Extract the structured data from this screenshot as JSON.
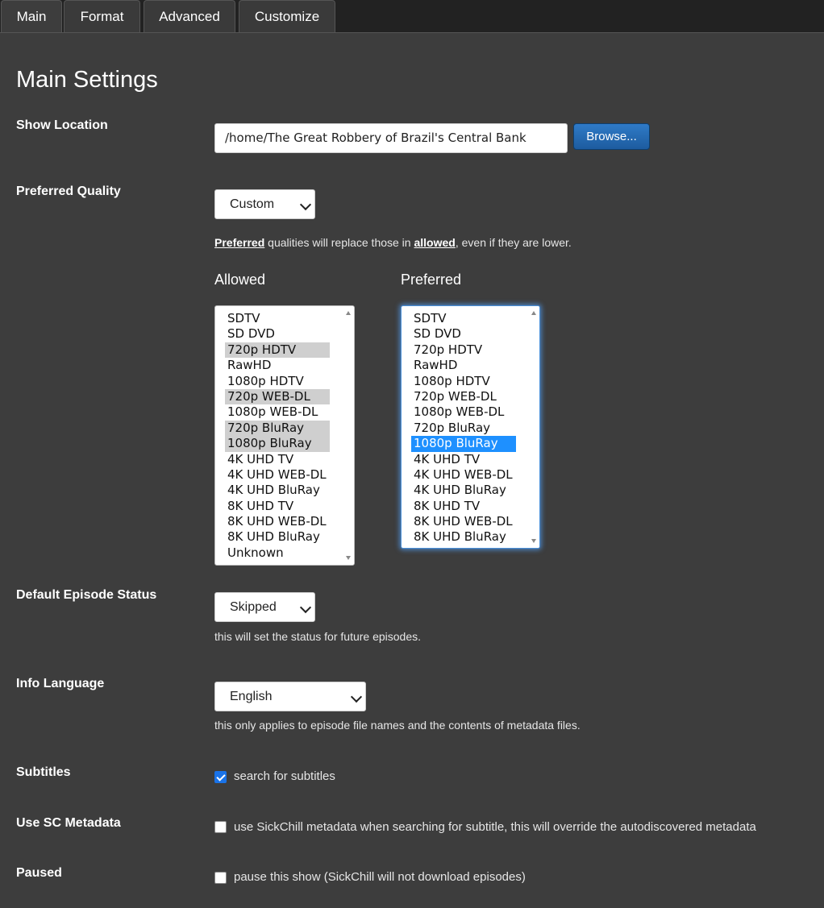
{
  "tabs": [
    {
      "label": "Main",
      "active": true
    },
    {
      "label": "Format",
      "active": false
    },
    {
      "label": "Advanced",
      "active": false
    },
    {
      "label": "Customize",
      "active": false
    }
  ],
  "page_title": "Main Settings",
  "show_location": {
    "label": "Show Location",
    "value": "/home/The Great Robbery of Brazil's Central Bank",
    "browse_label": "Browse..."
  },
  "preferred_quality": {
    "label": "Preferred Quality",
    "selected": "Custom",
    "hint_preferred": "Preferred",
    "hint_mid": " qualities will replace those in ",
    "hint_allowed": "allowed",
    "hint_end": ", even if they are lower.",
    "allowed_title": "Allowed",
    "preferred_title": "Preferred",
    "allowed_options": [
      "SDTV",
      "SD DVD",
      "720p HDTV",
      "RawHD",
      "1080p HDTV",
      "720p WEB-DL",
      "1080p WEB-DL",
      "720p BluRay",
      "1080p BluRay",
      "4K UHD TV",
      "4K UHD WEB-DL",
      "4K UHD BluRay",
      "8K UHD TV",
      "8K UHD WEB-DL",
      "8K UHD BluRay",
      "Unknown"
    ],
    "allowed_selected": [
      "720p HDTV",
      "720p WEB-DL",
      "720p BluRay",
      "1080p BluRay"
    ],
    "preferred_options": [
      "SDTV",
      "SD DVD",
      "720p HDTV",
      "RawHD",
      "1080p HDTV",
      "720p WEB-DL",
      "1080p WEB-DL",
      "720p BluRay",
      "1080p BluRay",
      "4K UHD TV",
      "4K UHD WEB-DL",
      "4K UHD BluRay",
      "8K UHD TV",
      "8K UHD WEB-DL",
      "8K UHD BluRay"
    ],
    "preferred_selected": [
      "1080p BluRay"
    ]
  },
  "default_episode_status": {
    "label": "Default Episode Status",
    "selected": "Skipped",
    "hint": "this will set the status for future episodes."
  },
  "info_language": {
    "label": "Info Language",
    "selected": "English",
    "hint": "this only applies to episode file names and the contents of metadata files."
  },
  "subtitles": {
    "label": "Subtitles",
    "checked": true,
    "text": "search for subtitles"
  },
  "use_sc_metadata": {
    "label": "Use SC Metadata",
    "checked": false,
    "text": "use SickChill metadata when searching for subtitle, this will override the autodiscovered metadata"
  },
  "paused": {
    "label": "Paused",
    "checked": false,
    "text": "pause this show (SickChill will not download episodes)"
  },
  "colors": {
    "accent": "#1e90ff",
    "panel": "#3d3d3d",
    "button": "#1d5c9f"
  }
}
